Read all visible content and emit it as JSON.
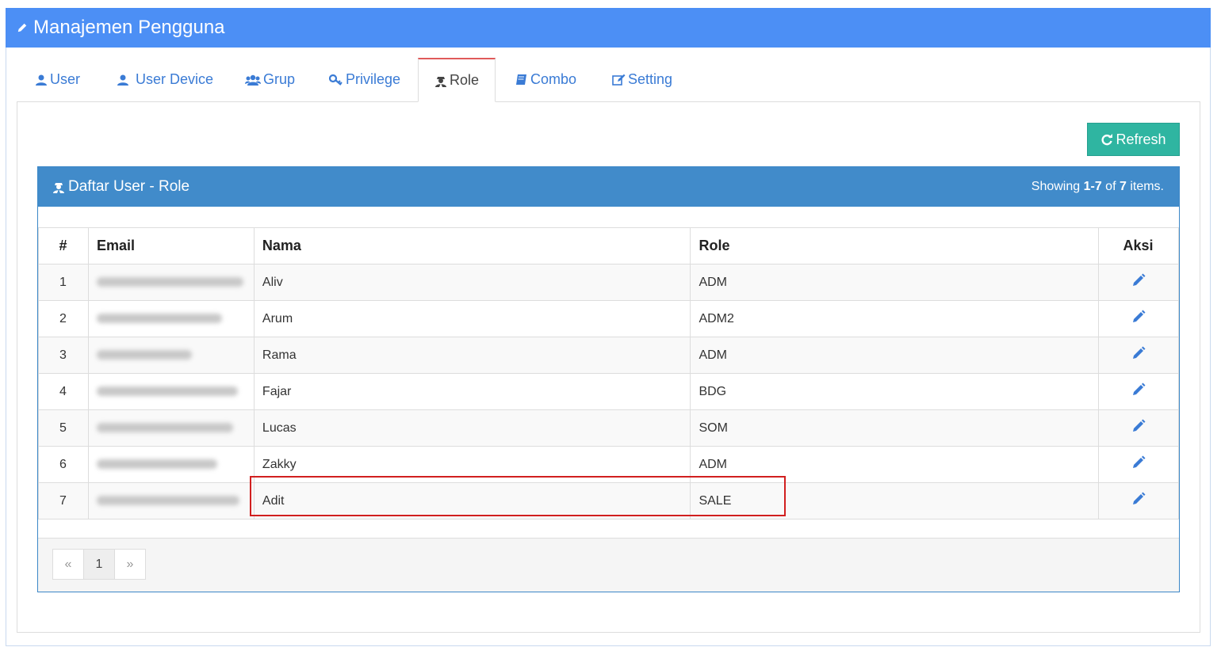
{
  "page": {
    "title": "Manajemen Pengguna"
  },
  "tabs": [
    {
      "label": "User",
      "icon": "user-icon"
    },
    {
      "label": "User Device",
      "icon": "user-icon"
    },
    {
      "label": "Grup",
      "icon": "users-icon"
    },
    {
      "label": "Privilege",
      "icon": "key-icon"
    },
    {
      "label": "Role",
      "icon": "user-secret-icon",
      "active": true
    },
    {
      "label": "Combo",
      "icon": "book-icon"
    },
    {
      "label": "Setting",
      "icon": "edit-icon"
    }
  ],
  "refresh_label": "Refresh",
  "grid": {
    "title": "Daftar User - Role",
    "summary": {
      "prefix": "Showing ",
      "range": "1-7",
      "of": " of ",
      "total": "7",
      "suffix": " items."
    },
    "columns": {
      "num": "#",
      "email": "Email",
      "nama": "Nama",
      "role": "Role",
      "aksi": "Aksi"
    },
    "rows": [
      {
        "num": "1",
        "nama": "Aliv",
        "role": "ADM"
      },
      {
        "num": "2",
        "nama": "Arum",
        "role": "ADM2"
      },
      {
        "num": "3",
        "nama": "Rama",
        "role": "ADM"
      },
      {
        "num": "4",
        "nama": "Fajar",
        "role": "BDG"
      },
      {
        "num": "5",
        "nama": "Lucas",
        "role": "SOM"
      },
      {
        "num": "6",
        "nama": "Zakky",
        "role": "ADM"
      },
      {
        "num": "7",
        "nama": "Adit",
        "role": "SALE"
      }
    ]
  },
  "pagination": {
    "prev": "«",
    "current": "1",
    "next": "»"
  },
  "colors": {
    "header": "#4c8ff5",
    "grid_header": "#418bca",
    "refresh": "#2fb5a1",
    "highlight": "#d11f1f",
    "active_tab_top": "#e05a5a"
  }
}
